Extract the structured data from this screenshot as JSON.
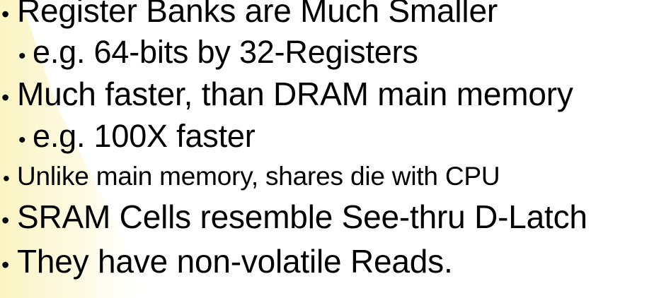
{
  "colors": {
    "background": "#ffffff",
    "text": "#000000",
    "glow": "#fbf6c7"
  },
  "bullet_glyph": "•",
  "bullets": [
    {
      "level": 1,
      "text": "Register Banks are Much Smaller"
    },
    {
      "level": 2,
      "text": "e.g. 64-bits by 32-Registers"
    },
    {
      "level": 1,
      "text": "Much faster, than DRAM main memory"
    },
    {
      "level": 2,
      "text": "e.g. 100X faster"
    },
    {
      "level": 1,
      "text": "Unlike main memory, shares die with CPU"
    },
    {
      "level": 1,
      "text": "SRAM Cells resemble See-thru D-Latch"
    },
    {
      "level": 1,
      "text": "They have non-volatile Reads."
    }
  ]
}
